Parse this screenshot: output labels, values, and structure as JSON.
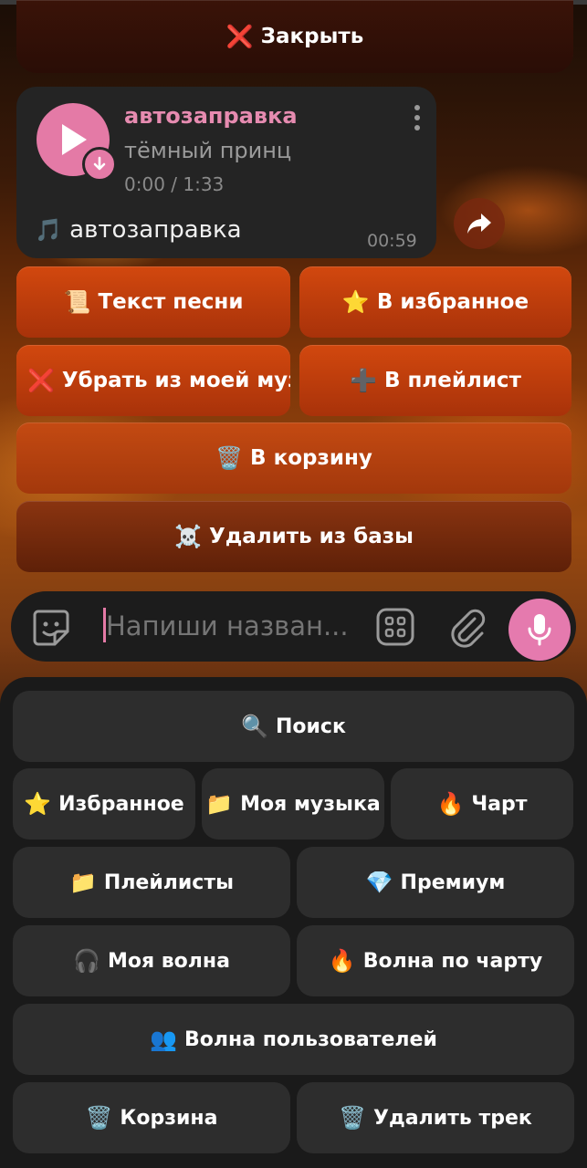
{
  "inline_keyboard": {
    "close": {
      "icon": "❌",
      "label": "Закрыть"
    },
    "lyrics": {
      "icon": "📜",
      "label": "Текст песни"
    },
    "favorite": {
      "icon": "⭐",
      "label": "В избранное"
    },
    "remove_my_music": {
      "icon": "❌",
      "label": "Убрать из моей музыки"
    },
    "add_playlist": {
      "icon": "➕",
      "label": "В плейлист"
    },
    "to_trash": {
      "icon": "🗑️",
      "label": "В корзину"
    },
    "delete_db": {
      "icon": "☠️",
      "label": "Удалить из базы"
    }
  },
  "message": {
    "track_title": "автозаправка",
    "track_artist": "тёмный принц",
    "track_time": "0:00 / 1:33",
    "caption_icon": "🎵",
    "caption": "автозаправка",
    "sent_time": "00:59"
  },
  "input": {
    "placeholder": "Напиши назван..."
  },
  "reply_keyboard": {
    "search": {
      "icon": "🔍",
      "label": "Поиск"
    },
    "favorites": {
      "icon": "⭐",
      "label": "Избранное"
    },
    "my_music": {
      "icon": "📁",
      "label": "Моя музыка"
    },
    "chart": {
      "icon": "🔥",
      "label": "Чарт"
    },
    "playlists": {
      "icon": "📁",
      "label": "Плейлисты"
    },
    "premium": {
      "icon": "💎",
      "label": "Премиум"
    },
    "my_wave": {
      "icon": "🎧",
      "label": "Моя волна"
    },
    "chart_wave": {
      "icon": "🔥",
      "label": "Волна по чарту"
    },
    "users_wave": {
      "icon": "👥",
      "label": "Волна пользователей"
    },
    "trash": {
      "icon": "🗑️",
      "label": "Корзина"
    },
    "delete_track": {
      "icon": "🗑️",
      "label": "Удалить трек"
    }
  },
  "icons": {
    "sticker": "sticker-icon",
    "apps": "apps-grid-icon",
    "attach": "paperclip-icon",
    "mic": "microphone-icon",
    "share": "share-arrow-icon",
    "download": "download-arrow-icon"
  },
  "colors": {
    "accent_pink": "#e47aa6",
    "inline_button": "#c2410c",
    "keyboard_bg": "#1a1a1a",
    "keyboard_button": "#2d2d2d"
  }
}
